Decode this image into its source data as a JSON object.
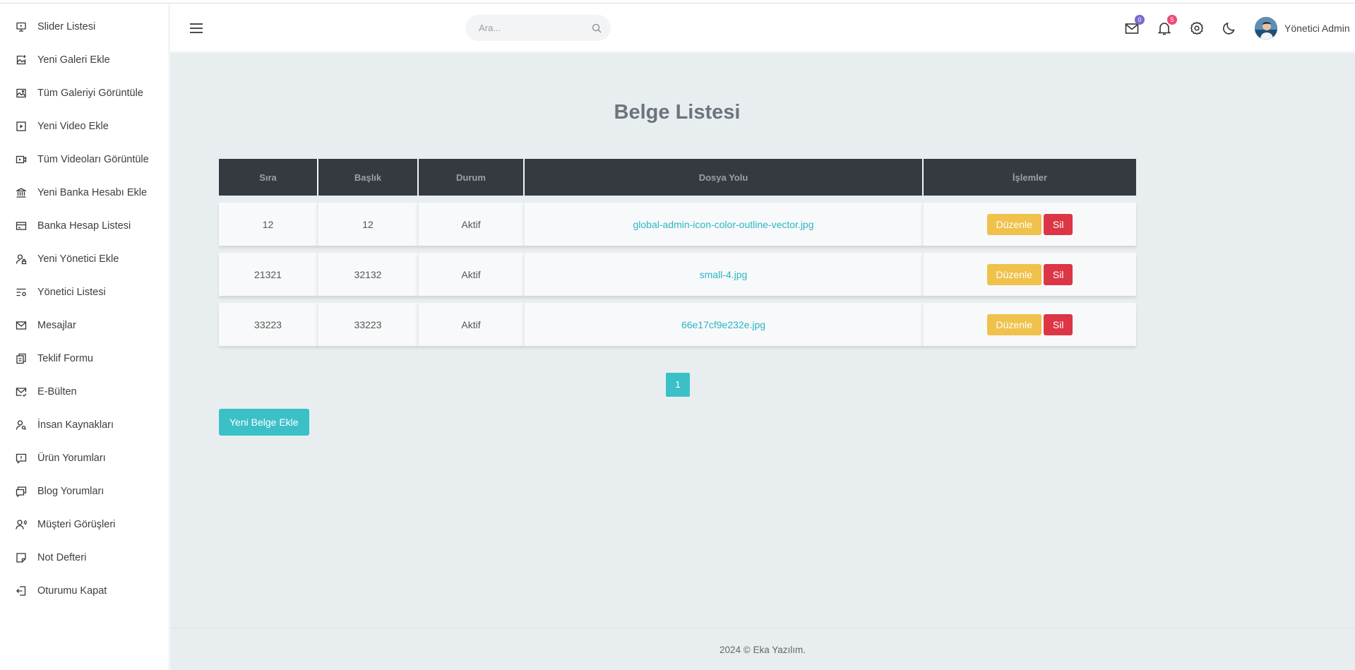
{
  "sidebar": {
    "items": [
      {
        "label": "Slider Listesi",
        "icon": "slider-icon"
      },
      {
        "label": "Yeni Galeri Ekle",
        "icon": "gallery-add-icon"
      },
      {
        "label": "Tüm Galeriyi Görüntüle",
        "icon": "image-icon"
      },
      {
        "label": "Yeni Video Ekle",
        "icon": "video-play-icon"
      },
      {
        "label": "Tüm Videoları Görüntüle",
        "icon": "video-camera-icon"
      },
      {
        "label": "Yeni Banka Hesabı Ekle",
        "icon": "bank-icon"
      },
      {
        "label": "Banka Hesap Listesi",
        "icon": "credit-card-icon"
      },
      {
        "label": "Yeni Yönetici Ekle",
        "icon": "user-lock-icon"
      },
      {
        "label": "Yönetici Listesi",
        "icon": "list-settings-icon"
      },
      {
        "label": "Mesajlar",
        "icon": "mail-icon"
      },
      {
        "label": "Teklif Formu",
        "icon": "file-copy-icon"
      },
      {
        "label": "E-Bülten",
        "icon": "mail-check-icon"
      },
      {
        "label": "İnsan Kaynakları",
        "icon": "user-search-icon"
      },
      {
        "label": "Ürün Yorumları",
        "icon": "feedback-icon"
      },
      {
        "label": "Blog Yorumları",
        "icon": "chat-box-icon"
      },
      {
        "label": "Müşteri Görüşleri",
        "icon": "user-voice-icon"
      },
      {
        "label": "Not Defteri",
        "icon": "sticky-note-icon"
      },
      {
        "label": "Oturumu Kapat",
        "icon": "logout-icon"
      }
    ]
  },
  "header": {
    "search_placeholder": "Ara...",
    "mail_count": "0",
    "notification_count": "5",
    "user_name": "Yönetici Admin"
  },
  "main": {
    "title": "Belge Listesi",
    "columns": [
      "Sıra",
      "Başlık",
      "Durum",
      "Dosya Yolu",
      "İşlemler"
    ],
    "rows": [
      {
        "sira": "12",
        "baslik": "12",
        "durum": "Aktif",
        "dosya": "global-admin-icon-color-outline-vector.jpg"
      },
      {
        "sira": "21321",
        "baslik": "32132",
        "durum": "Aktif",
        "dosya": "small-4.jpg"
      },
      {
        "sira": "33223",
        "baslik": "33223",
        "durum": "Aktif",
        "dosya": "66e17cf9e232e.jpg"
      }
    ],
    "edit_label": "Düzenle",
    "delete_label": "Sil",
    "page": "1",
    "new_button": "Yeni Belge Ekle"
  },
  "footer": {
    "text": "2024 © Eka Yazılım."
  },
  "colors": {
    "accent": "#3cc0c8",
    "edit": "#f0c14b",
    "delete": "#dc3545",
    "table_header": "#343a40",
    "background": "#e8eef0"
  }
}
